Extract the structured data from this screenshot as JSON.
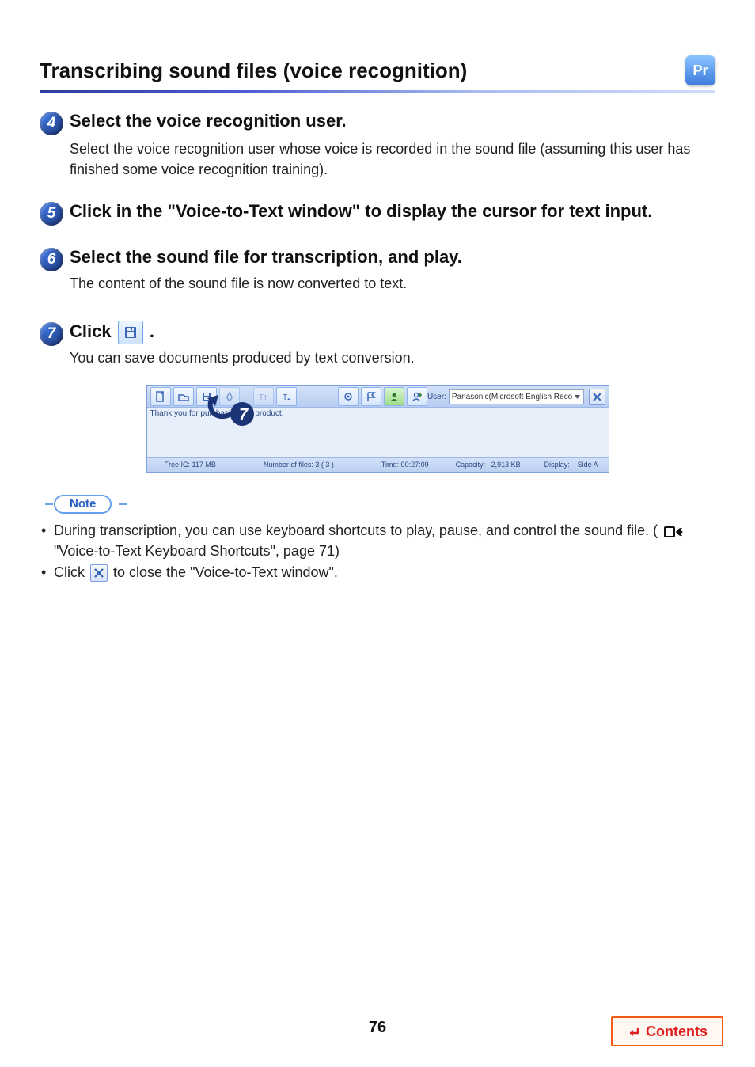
{
  "title": "Transcribing sound files (voice recognition)",
  "pr_badge": "Pr",
  "page_number": "76",
  "contents_label": "Contents",
  "steps": {
    "s4": {
      "num": "4",
      "head": "Select the voice recognition user.",
      "body": "Select the voice recognition user whose voice is recorded in the sound file (assuming this user has finished some voice recognition training)."
    },
    "s5": {
      "num": "5",
      "head": "Click in the \"Voice-to-Text window\" to display the cursor for text input."
    },
    "s6": {
      "num": "6",
      "head": "Select the sound file for transcription, and play.",
      "body": "The content of the sound file is now converted to text."
    },
    "s7": {
      "num": "7",
      "head_prefix": "Click ",
      "head_suffix": ".",
      "body": "You can save documents produced by text conversion.",
      "callout": "7"
    }
  },
  "shot": {
    "toolbar": {
      "user_label": "User:",
      "user_value": "Panasonic(Microsoft English Reco"
    },
    "text": "Thank you for purchasing our product.",
    "status": {
      "free": "Free IC: 117 MB",
      "files": "Number of files: 3 ( 3 )",
      "time": "Time: 00:27:09",
      "cap": "Capacity:   2,913 KB",
      "disp": "Display:    Side A"
    }
  },
  "note": {
    "label": "Note",
    "items": {
      "i1_prefix": "During transcription, you can use keyboard shortcuts to play, pause, and control the sound file. (",
      "i1_link": " \"Voice-to-Text Keyboard Shortcuts\", page 71)",
      "i2_prefix": "Click ",
      "i2_suffix": " to close the \"Voice-to-Text window\"."
    }
  }
}
